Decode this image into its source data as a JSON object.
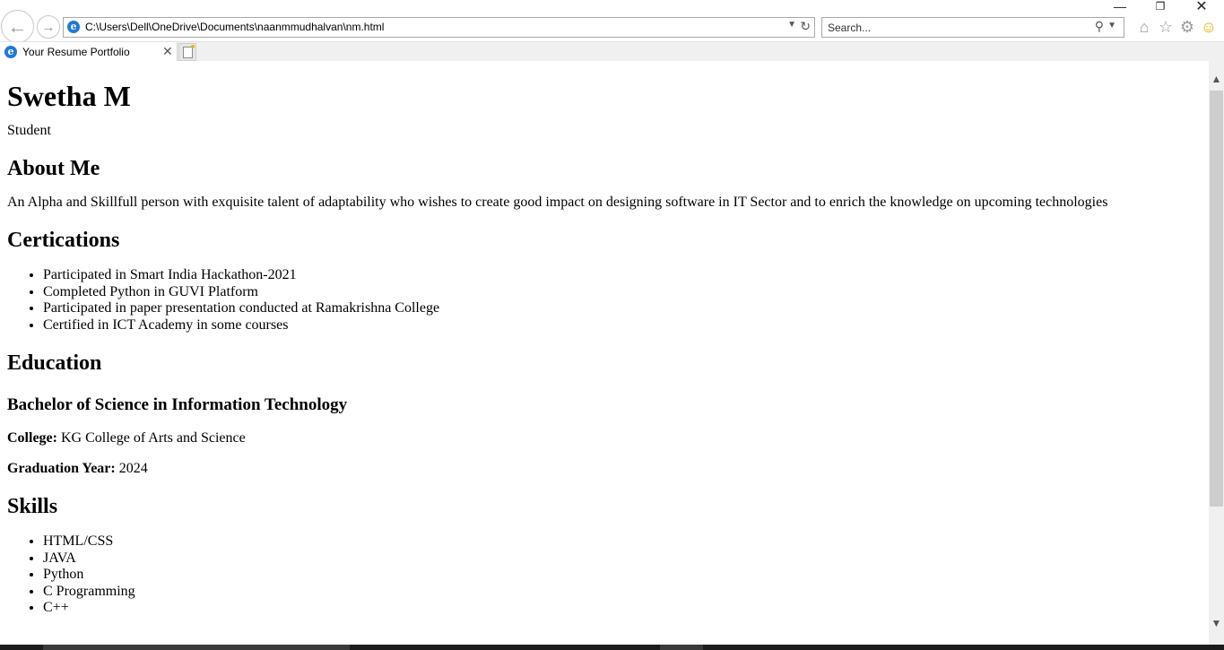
{
  "browser": {
    "address": "C:\\Users\\Dell\\OneDrive\\Documents\\naanmmudhalvan\\nm.html",
    "search_placeholder": "Search...",
    "tab_title": "Your Resume Portfolio",
    "icons": {
      "back": "back-arrow-icon",
      "forward": "forward-arrow-icon",
      "home": "home-icon",
      "favorites": "star-icon",
      "tools": "gear-icon",
      "feedback": "smiley-icon"
    }
  },
  "page": {
    "name": "Swetha M",
    "role": "Student",
    "about": {
      "heading": "About Me",
      "text": "An Alpha and Skillfull person with exquisite talent of adaptability who wishes to create good impact on designing software in IT Sector and to enrich the knowledge on upcoming technologies"
    },
    "certifications": {
      "heading": "Certications",
      "items": [
        "Participated in Smart India Hackathon-2021",
        "Completed Python in GUVI Platform",
        "Participated in paper presentation conducted at Ramakrishna College",
        "Certified in ICT Academy in some courses"
      ]
    },
    "education": {
      "heading": "Education",
      "degree": "Bachelor of Science in Information Technology",
      "college_label": "College:",
      "college": "KG College of Arts and Science",
      "year_label": "Graduation Year:",
      "year": "2024"
    },
    "skills": {
      "heading": "Skills",
      "items": [
        "HTML/CSS",
        "JAVA",
        "Python",
        "C Programming",
        "C++"
      ]
    }
  }
}
